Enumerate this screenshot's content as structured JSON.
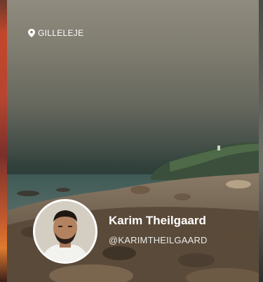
{
  "location": {
    "icon": "map-pin-icon",
    "label": "GILLELEJE"
  },
  "profile": {
    "name": "Karim Theilgaard",
    "handle": "@KARIMTHEILGAARD",
    "avatar": "profile-photo"
  },
  "colors": {
    "text": "#ffffff",
    "avatar_border": "#ffffff"
  }
}
